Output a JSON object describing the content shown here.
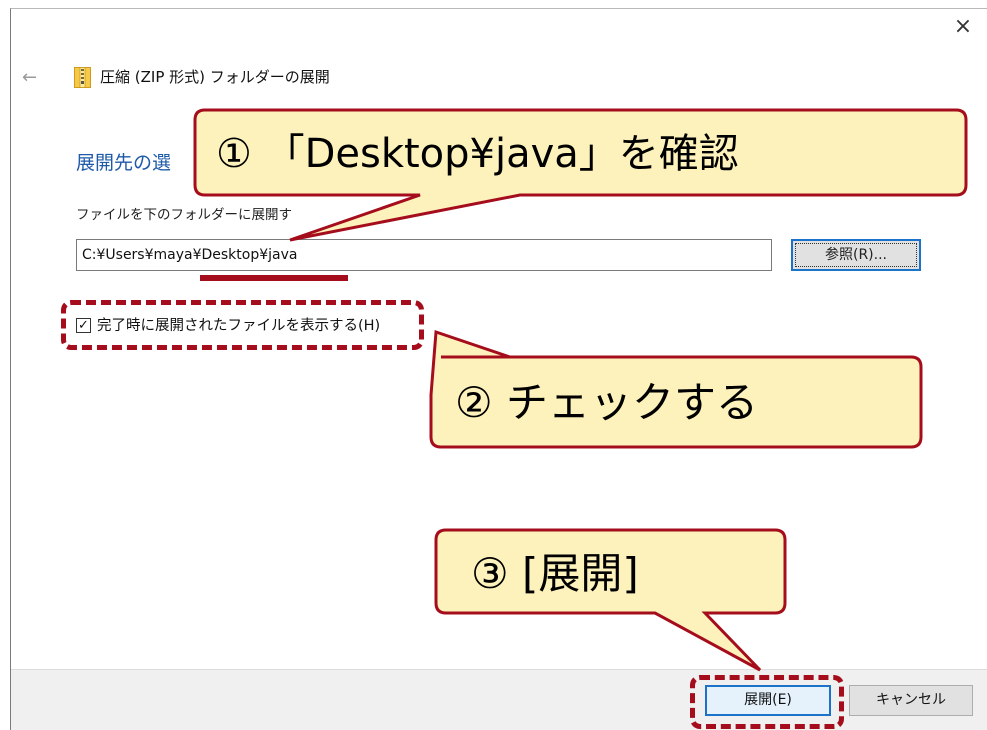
{
  "window": {
    "close_glyph": "×",
    "back_glyph": "←",
    "title": "圧縮 (ZIP 形式) フォルダーの展開"
  },
  "main": {
    "heading": "展開先の選",
    "destination_label": "ファイルを下のフォルダーに展開す",
    "destination_value": "C:¥Users¥maya¥Desktop¥java",
    "browse_button": "参照(R)...",
    "show_files_checkbox": {
      "checked": true,
      "label": "完了時に展開されたファイルを表示する(H)"
    }
  },
  "footer": {
    "extract_button": "展開(E)",
    "cancel_button": "キャンセル"
  },
  "annotations": {
    "callout1": "① 「Desktop¥java」を確認",
    "callout2": "② チェックする",
    "callout3": "③ [展開]"
  },
  "colors": {
    "callout_fill": "#fdf2bb",
    "callout_border": "#a50d1c",
    "heading_blue": "#1e5aa8",
    "focus_blue": "#1a73c9",
    "dialog_footer": "#f0f0f0"
  },
  "icons": [
    "close-icon",
    "back-arrow-icon",
    "zip-folder-icon",
    "checkmark-icon"
  ]
}
